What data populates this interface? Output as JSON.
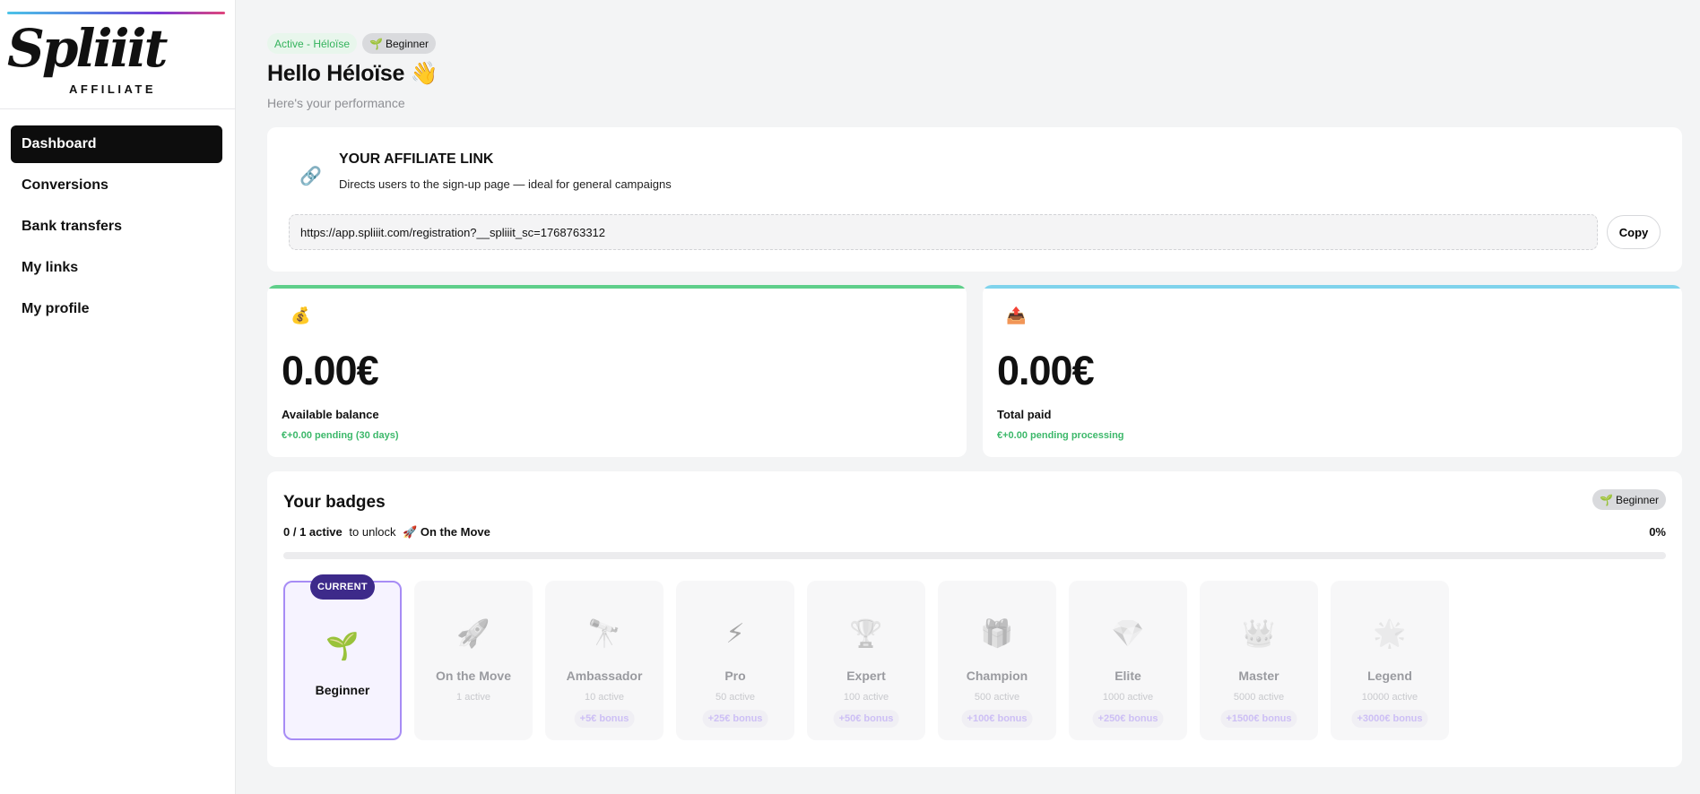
{
  "brand": {
    "logo_script": "Spliiit",
    "logo_sub": "AFFILIATE"
  },
  "sidebar": {
    "items": [
      {
        "label": "Dashboard",
        "active": true
      },
      {
        "label": "Conversions"
      },
      {
        "label": "Bank transfers"
      },
      {
        "label": "My links"
      },
      {
        "label": "My profile"
      }
    ]
  },
  "header": {
    "status_chip": "Active - Héloïse",
    "level_chip_icon": "seedling-icon",
    "level_chip": "Beginner",
    "greeting": "Hello Héloïse 👋",
    "subtitle": "Here's your performance"
  },
  "affiliate_link": {
    "icon": "link-icon",
    "title": "YOUR AFFILIATE LINK",
    "description": "Directs users to the sign-up page — ideal for general campaigns",
    "url": "https://app.spliiit.com/registration?__spliiit_sc=1768763312",
    "copy_label": "Copy"
  },
  "stats": [
    {
      "icon": "money-bag-icon",
      "value": "0.00€",
      "label": "Available balance",
      "note": "€+0.00 pending (30 days)",
      "accent": "#5fcf8a"
    },
    {
      "icon": "outbox-tray-icon",
      "value": "0.00€",
      "label": "Total paid",
      "note": "€+0.00 pending processing",
      "accent": "#7fd3ec"
    }
  ],
  "badges": {
    "title": "Your badges",
    "level_chip": "Beginner",
    "progress_count": "0 / 1 active",
    "progress_text": "to unlock",
    "next_badge": "🚀 On the Move",
    "progress_percent": "0%",
    "progress_fraction": 0,
    "current_tag": "CURRENT",
    "items": [
      {
        "icon": "seedling-icon",
        "glyph": "🌱",
        "name": "Beginner",
        "current": true
      },
      {
        "icon": "rocket-icon",
        "glyph": "🚀",
        "name": "On the Move",
        "requirement": "1 active"
      },
      {
        "icon": "telescope-icon",
        "glyph": "🔭",
        "name": "Ambassador",
        "requirement": "10 active",
        "bonus": "+5€ bonus"
      },
      {
        "icon": "lightning-icon",
        "glyph": "⚡",
        "name": "Pro",
        "requirement": "50 active",
        "bonus": "+25€ bonus"
      },
      {
        "icon": "trophy-icon",
        "glyph": "🏆",
        "name": "Expert",
        "requirement": "100 active",
        "bonus": "+50€ bonus"
      },
      {
        "icon": "gift-icon",
        "glyph": "🎁",
        "name": "Champion",
        "requirement": "500 active",
        "bonus": "+100€ bonus"
      },
      {
        "icon": "diamond-icon",
        "glyph": "💎",
        "name": "Elite",
        "requirement": "1000 active",
        "bonus": "+250€ bonus"
      },
      {
        "icon": "crown-icon",
        "glyph": "👑",
        "name": "Master",
        "requirement": "5000 active",
        "bonus": "+1500€ bonus"
      },
      {
        "icon": "star-icon",
        "glyph": "🌟",
        "name": "Legend",
        "requirement": "10000 active",
        "bonus": "+3000€ bonus"
      }
    ]
  }
}
